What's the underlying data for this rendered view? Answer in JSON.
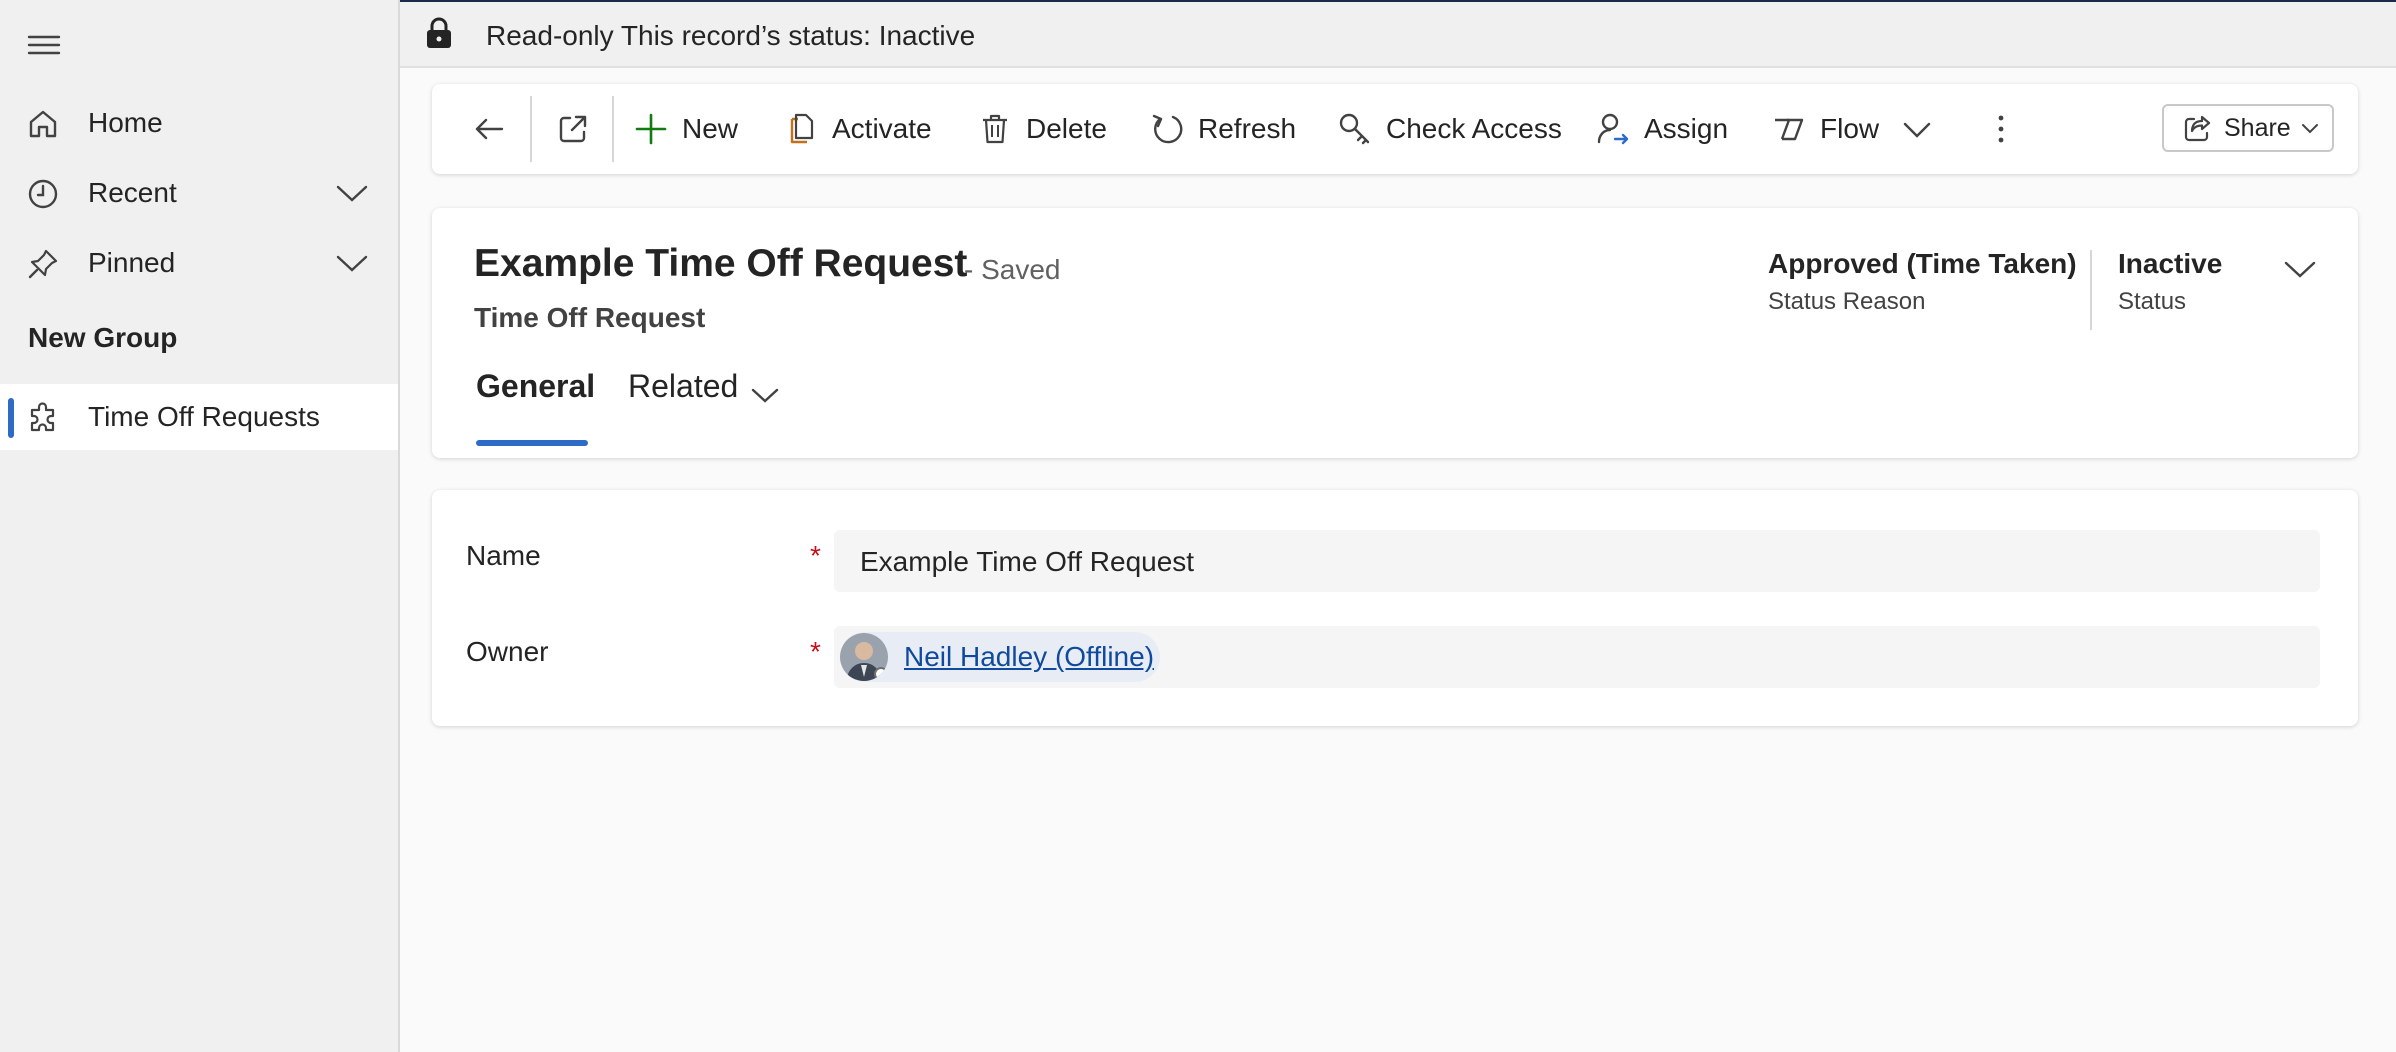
{
  "banner": {
    "text": "Read-only This record’s status: Inactive"
  },
  "sidebar": {
    "items": [
      {
        "label": "Home",
        "icon": "home-icon"
      },
      {
        "label": "Recent",
        "icon": "clock-icon"
      },
      {
        "label": "Pinned",
        "icon": "pin-icon"
      }
    ],
    "group_title": "New Group",
    "group_items": [
      {
        "label": "Time Off Requests",
        "icon": "puzzle-icon",
        "selected": true
      }
    ]
  },
  "toolbar": {
    "new_label": "New",
    "activate_label": "Activate",
    "delete_label": "Delete",
    "refresh_label": "Refresh",
    "check_access_label": "Check Access",
    "assign_label": "Assign",
    "flow_label": "Flow",
    "share_label": "Share"
  },
  "record": {
    "title": "Example Time Off Request",
    "saved_state": "- Saved",
    "entity": "Time Off Request",
    "header_fields": [
      {
        "value": "Approved (Time Taken)",
        "label": "Status Reason"
      },
      {
        "value": "Inactive",
        "label": "Status"
      }
    ],
    "tabs": [
      {
        "label": "General",
        "active": true
      },
      {
        "label": "Related",
        "active": false
      }
    ]
  },
  "form": {
    "name": {
      "label": "Name",
      "required_marker": "*",
      "value": "Example Time Off Request"
    },
    "owner": {
      "label": "Owner",
      "required_marker": "*",
      "value": "Neil Hadley (Offline)"
    }
  },
  "colors": {
    "accent": "#2e6bc6",
    "required": "#c50f1f",
    "link": "#0f4a9e",
    "new_icon": "#107c10",
    "activate_icon": "#c2701a"
  }
}
